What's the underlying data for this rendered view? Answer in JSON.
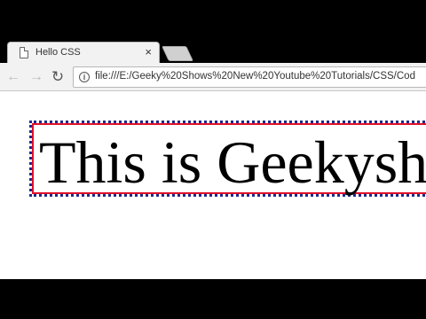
{
  "tab": {
    "title": "Hello CSS",
    "close_label": "×"
  },
  "toolbar": {
    "back_label": "←",
    "forward_label": "→",
    "reload_label": "↻",
    "url": "file:///E:/Geeky%20Shows%20New%20Youtube%20Tutorials/CSS/Cod"
  },
  "page": {
    "heading": "This is Geekysh"
  },
  "colors": {
    "heading_border": "#e0112b",
    "outline": "#1d2b8a"
  }
}
